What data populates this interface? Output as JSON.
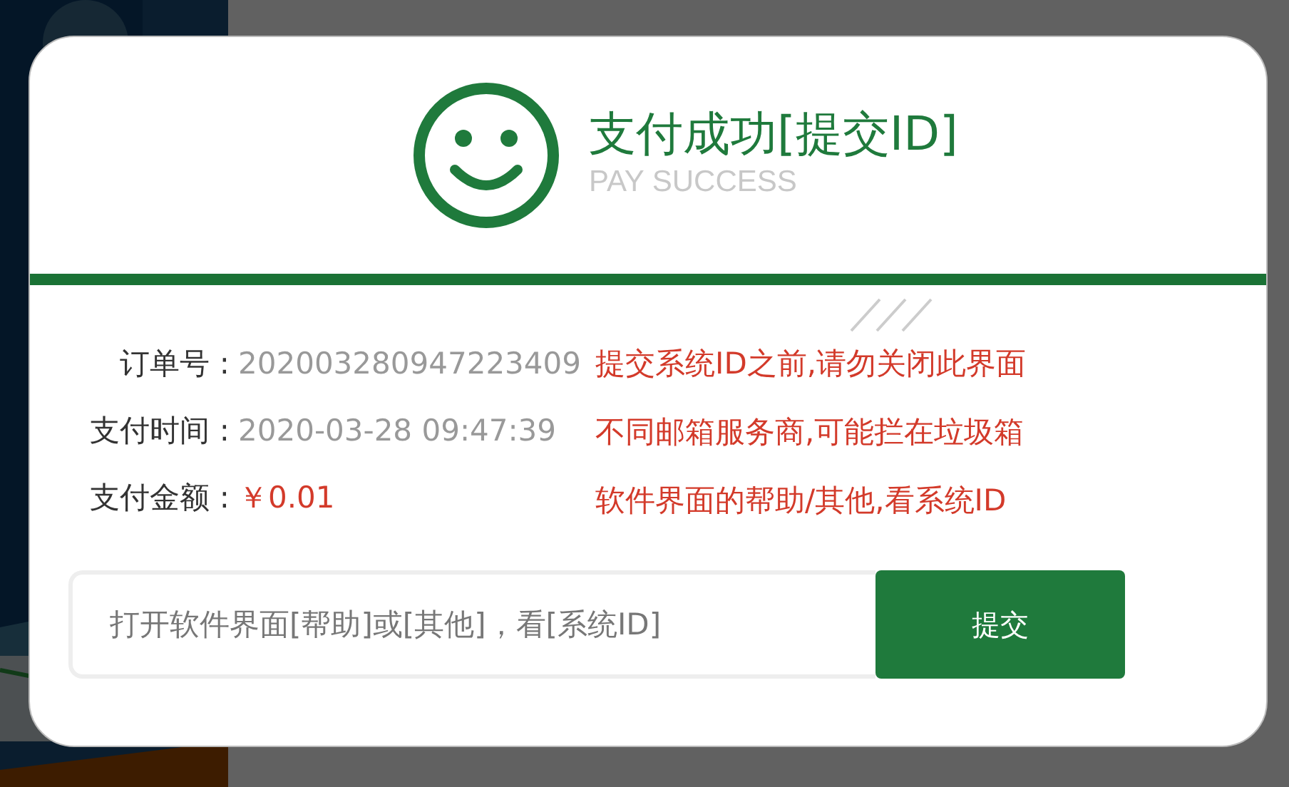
{
  "dialog": {
    "title": "支付成功[提交ID]",
    "subtitle": "PAY SUCCESS",
    "details": [
      {
        "label": "订单号 :",
        "value": "202003280947223409",
        "kind": "text"
      },
      {
        "label": "支付时间 :",
        "value": "2020-03-28 09:47:39",
        "kind": "text"
      },
      {
        "label": "支付金额 :",
        "value": "￥0.01",
        "kind": "amount"
      }
    ],
    "notices": [
      "提交系统ID之前,请勿关闭此界面",
      "不同邮箱服务商,可能拦在垃圾箱",
      "软件界面的帮助/其他,看系统ID"
    ],
    "input": {
      "placeholder": "打开软件界面[帮助]或[其他]，看[系统ID]"
    },
    "button": "提交"
  }
}
